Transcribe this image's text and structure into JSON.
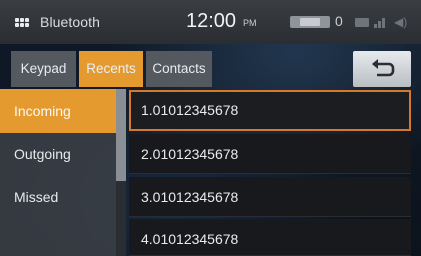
{
  "status_bar": {
    "source": "Bluetooth",
    "time": "12:00",
    "ampm": "PM",
    "battery_badge": "",
    "phone_count": "0"
  },
  "tabs": [
    {
      "label": "Keypad",
      "active": false
    },
    {
      "label": "Recents",
      "active": true
    },
    {
      "label": "Contacts",
      "active": false
    }
  ],
  "back_button": {
    "icon": "return-arrow-icon"
  },
  "filters": [
    {
      "label": "Incoming",
      "active": true
    },
    {
      "label": "Outgoing",
      "active": false
    },
    {
      "label": "Missed",
      "active": false
    }
  ],
  "calls": [
    {
      "label": "1.01012345678",
      "selected": true
    },
    {
      "label": "2.01012345678",
      "selected": false
    },
    {
      "label": "3.01012345678",
      "selected": false
    },
    {
      "label": "4.01012345678",
      "selected": false
    }
  ],
  "colors": {
    "accent": "#e59a2f",
    "selection_border": "#d6792c",
    "tab_inactive": "#54595f",
    "row_bg": "#17191c"
  }
}
